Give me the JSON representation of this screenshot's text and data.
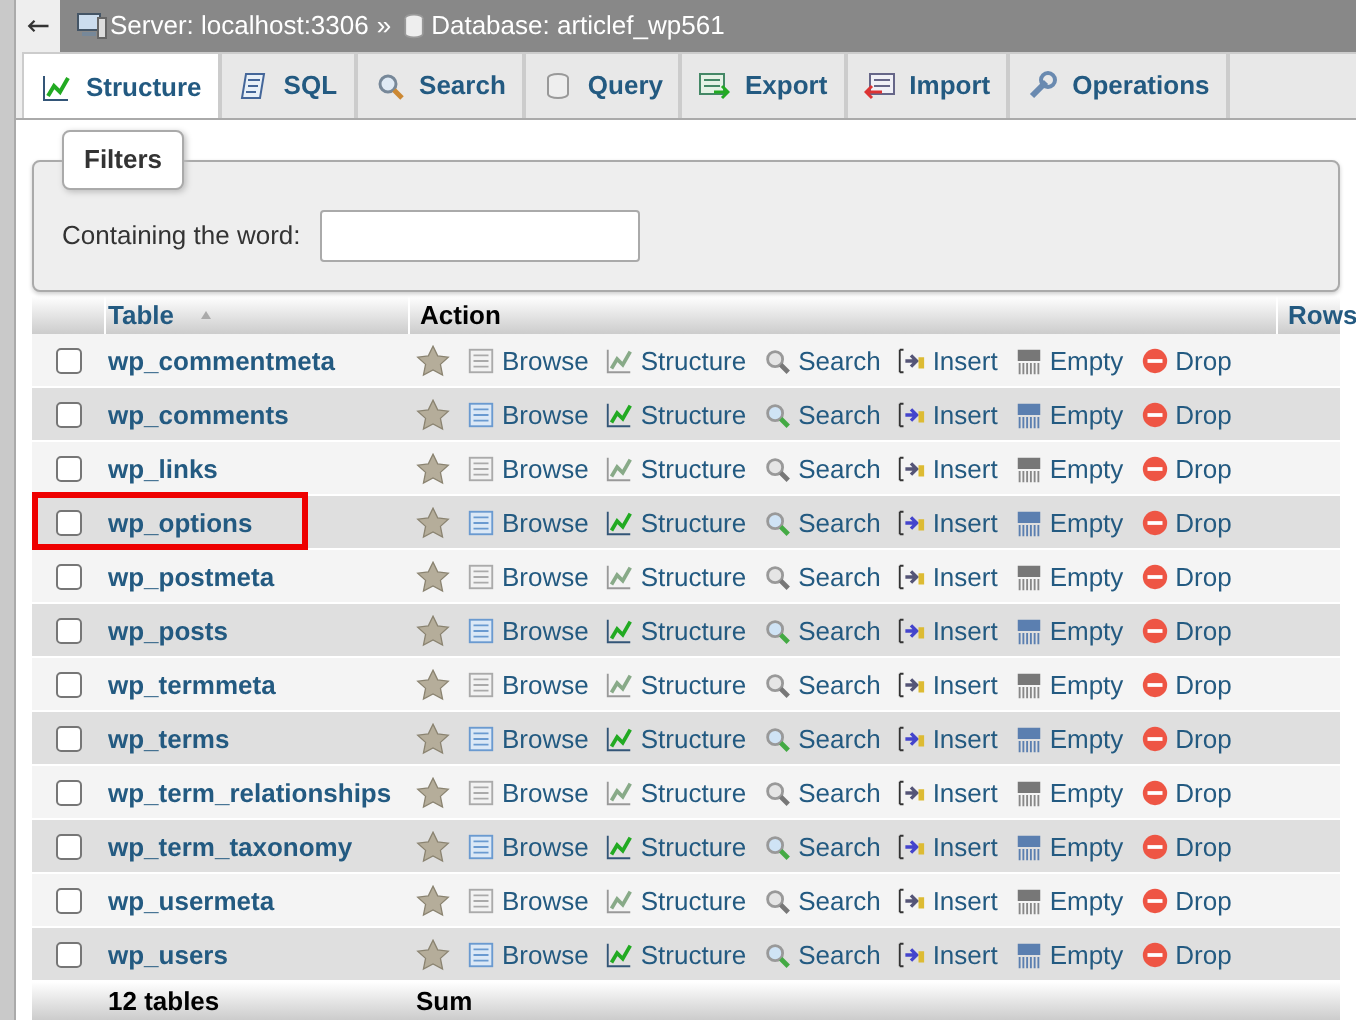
{
  "breadcrumb": {
    "server": "Server: localhost:3306",
    "separator": "»",
    "database": "Database: articlef_wp561"
  },
  "tabs": [
    {
      "label": "Structure",
      "selected": true
    },
    {
      "label": "SQL",
      "selected": false
    },
    {
      "label": "Search",
      "selected": false
    },
    {
      "label": "Query",
      "selected": false
    },
    {
      "label": "Export",
      "selected": false
    },
    {
      "label": "Import",
      "selected": false
    },
    {
      "label": "Operations",
      "selected": false
    }
  ],
  "filters": {
    "legend": "Filters",
    "label": "Containing the word:"
  },
  "table": {
    "columns": [
      "Table",
      "Action",
      "Rows"
    ],
    "rows": [
      {
        "name": "wp_commentmeta",
        "checked": false,
        "highlighted": false,
        "actions": [
          "Browse",
          "Structure",
          "Search",
          "Insert",
          "Empty",
          "Drop"
        ]
      },
      {
        "name": "wp_comments",
        "checked": false,
        "highlighted": false,
        "actions": [
          "Browse",
          "Structure",
          "Search",
          "Insert",
          "Empty",
          "Drop"
        ]
      },
      {
        "name": "wp_links",
        "checked": false,
        "highlighted": false,
        "actions": [
          "Browse",
          "Structure",
          "Search",
          "Insert",
          "Empty",
          "Drop"
        ]
      },
      {
        "name": "wp_options",
        "checked": false,
        "highlighted": true,
        "actions": [
          "Browse",
          "Structure",
          "Search",
          "Insert",
          "Empty",
          "Drop"
        ]
      },
      {
        "name": "wp_postmeta",
        "checked": false,
        "highlighted": false,
        "actions": [
          "Browse",
          "Structure",
          "Search",
          "Insert",
          "Empty",
          "Drop"
        ]
      },
      {
        "name": "wp_posts",
        "checked": false,
        "highlighted": false,
        "actions": [
          "Browse",
          "Structure",
          "Search",
          "Insert",
          "Empty",
          "Drop"
        ]
      },
      {
        "name": "wp_termmeta",
        "checked": false,
        "highlighted": false,
        "actions": [
          "Browse",
          "Structure",
          "Search",
          "Insert",
          "Empty",
          "Drop"
        ]
      },
      {
        "name": "wp_terms",
        "checked": false,
        "highlighted": false,
        "actions": [
          "Browse",
          "Structure",
          "Search",
          "Insert",
          "Empty",
          "Drop"
        ]
      },
      {
        "name": "wp_term_relationships",
        "checked": false,
        "highlighted": false,
        "actions": [
          "Browse",
          "Structure",
          "Search",
          "Insert",
          "Empty",
          "Drop"
        ]
      },
      {
        "name": "wp_term_taxonomy",
        "checked": false,
        "highlighted": false,
        "actions": [
          "Browse",
          "Structure",
          "Search",
          "Insert",
          "Empty",
          "Drop"
        ]
      },
      {
        "name": "wp_usermeta",
        "checked": false,
        "highlighted": false,
        "actions": [
          "Browse",
          "Structure",
          "Search",
          "Insert",
          "Empty",
          "Drop"
        ]
      },
      {
        "name": "wp_users",
        "checked": false,
        "highlighted": false,
        "actions": [
          "Browse",
          "Structure",
          "Search",
          "Insert",
          "Empty",
          "Drop"
        ]
      }
    ],
    "footer": {
      "count": "12 tables",
      "sum": "Sum"
    }
  }
}
